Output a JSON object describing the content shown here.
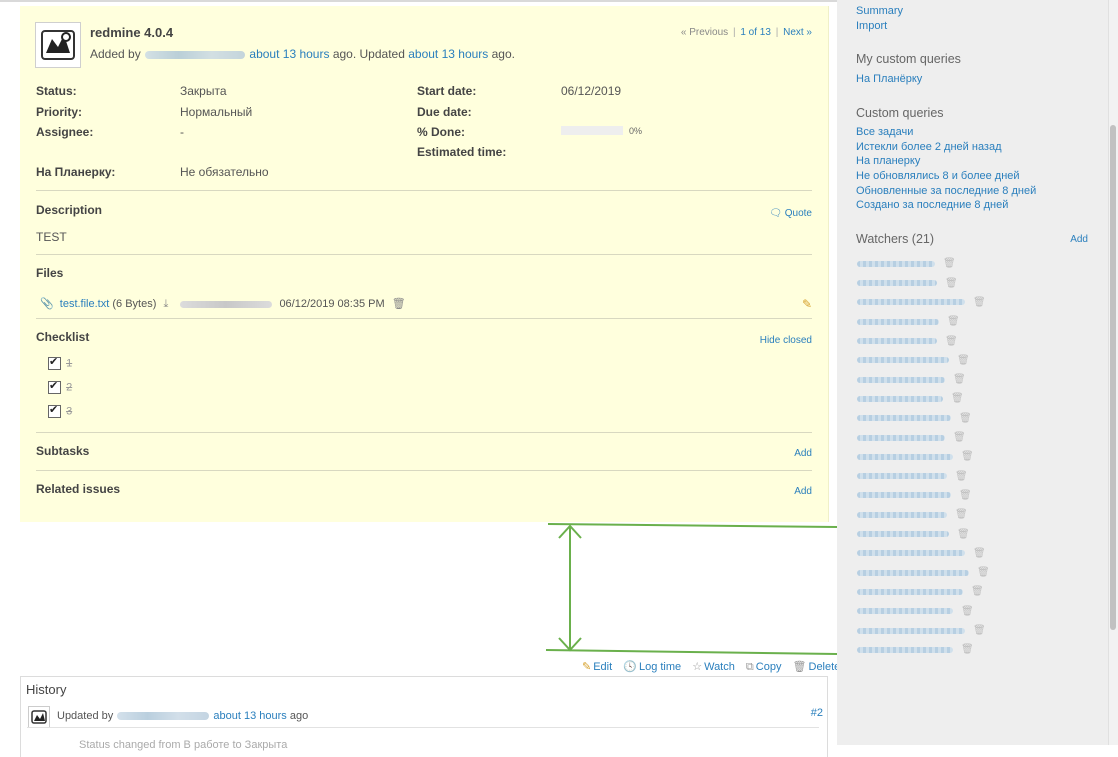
{
  "issue": {
    "subject": "redmine 4.0.4",
    "added_by_prefix": "Added by",
    "created_ago": "about 13 hours",
    "updated_mid": "ago. Updated",
    "updated_ago": "about 13 hours",
    "updated_suffix": "ago.",
    "nav": {
      "previous": "« Previous",
      "position": "1 of 13",
      "next": "Next »"
    },
    "attributes": {
      "status_label": "Status:",
      "status_value": "Закрыта",
      "priority_label": "Priority:",
      "priority_value": "Нормальный",
      "assignee_label": "Assignee:",
      "assignee_value": "-",
      "start_label": "Start date:",
      "start_value": "06/12/2019",
      "due_label": "Due date:",
      "due_value": "",
      "done_label": "% Done:",
      "done_value": "0%",
      "done_fraction": 0,
      "estimated_label": "Estimated time:",
      "estimated_value": "",
      "custom_label": "На Планерку:",
      "custom_value": "Не обязательно"
    },
    "description": {
      "title": "Description",
      "quote": "Quote",
      "text": "TEST"
    },
    "files": {
      "title": "Files",
      "name": "test.file.txt",
      "size": "(6 Bytes)",
      "date": "06/12/2019 08:35 PM"
    },
    "checklist": {
      "title": "Checklist",
      "hide_closed": "Hide closed",
      "items": [
        {
          "text": "1",
          "done": true
        },
        {
          "text": "2",
          "done": true
        },
        {
          "text": "3",
          "done": true
        }
      ]
    },
    "subtasks": {
      "title": "Subtasks",
      "add": "Add"
    },
    "related": {
      "title": "Related issues",
      "add": "Add"
    }
  },
  "actions": {
    "edit": "Edit",
    "log_time": "Log time",
    "watch": "Watch",
    "copy": "Copy",
    "delete": "Delete"
  },
  "history": {
    "title": "History",
    "entry": {
      "prefix": "Updated by",
      "ago": "about 13 hours",
      "suffix": "ago",
      "number": "#2",
      "detail": "Status changed from В работе to Закрыта"
    }
  },
  "sidebar": {
    "links_top": [
      "Summary",
      "Import"
    ],
    "my_queries_title": "My custom queries",
    "my_queries": [
      "На Планёрку"
    ],
    "custom_queries_title": "Custom queries",
    "custom_queries": [
      "Все задачи",
      "Истекли более 2 дней назад",
      "На планерку",
      "Не обновлялись 8 и более дней",
      "Обновленные за последние 8 дней",
      "Создано за последние 8 дней"
    ],
    "watchers_title": "Watchers (21)",
    "watchers_add": "Add",
    "watcher_count": 21
  },
  "colors": {
    "issue_bg": "#ffffdd",
    "link": "#2a7fbd",
    "sidebar_bg": "#eeeeee",
    "annotation": "#6ab04c"
  }
}
